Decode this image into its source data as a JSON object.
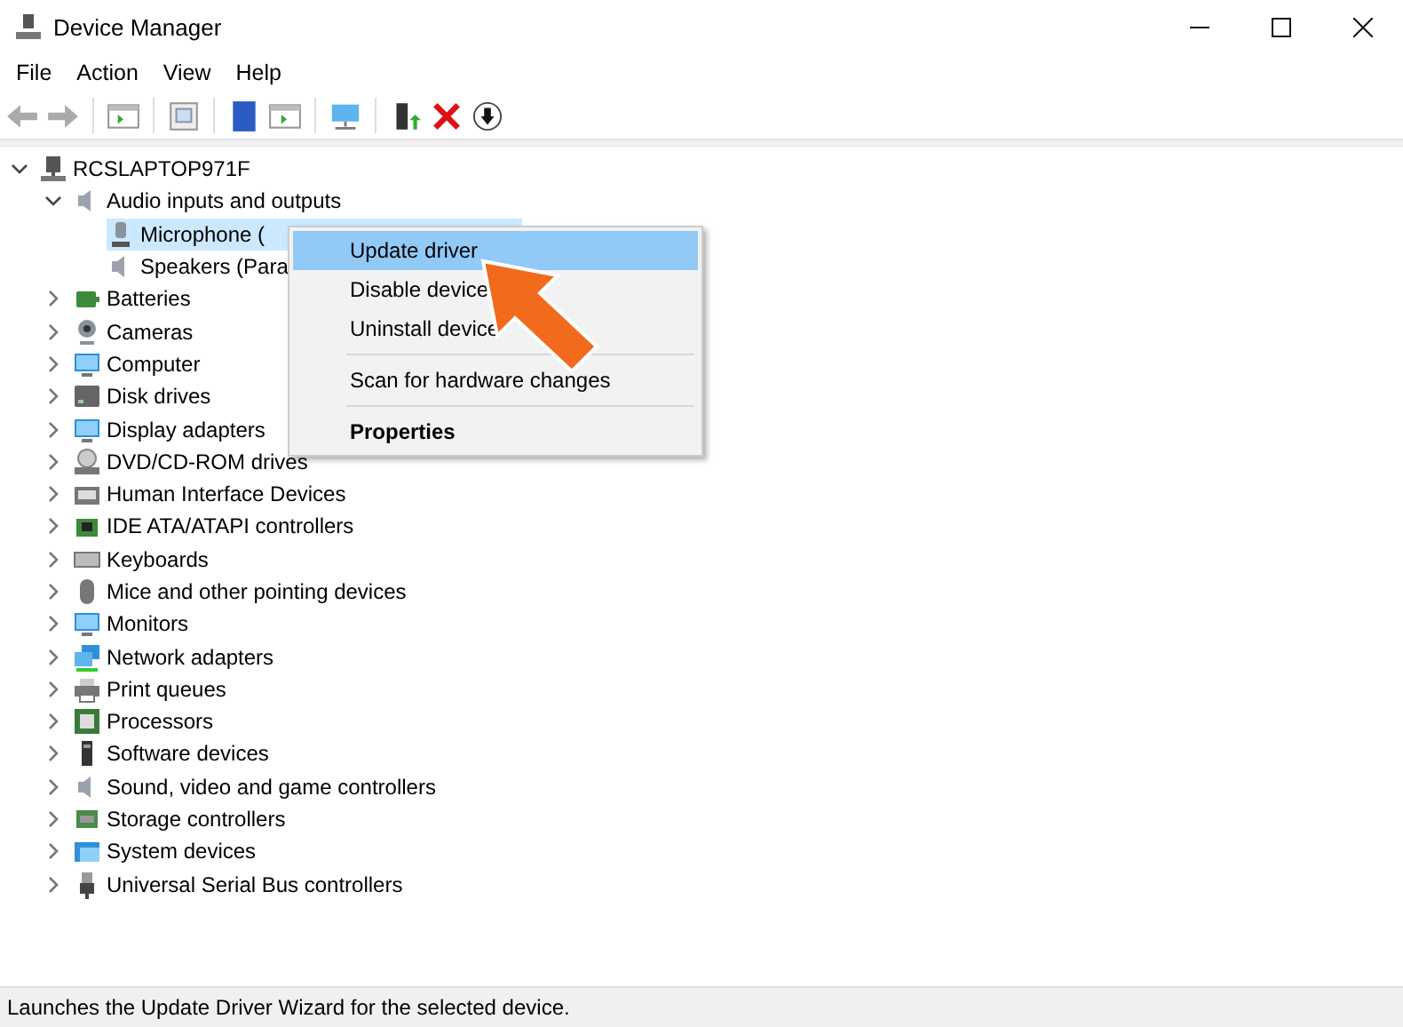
{
  "window": {
    "title": "Device Manager"
  },
  "menu_bar": [
    "File",
    "Action",
    "View",
    "Help"
  ],
  "tree": [
    {
      "label": "RCSLAPTOP971F",
      "expanded": true,
      "selected": false,
      "children": [
        {
          "label": "Audio inputs and outputs",
          "expanded": true,
          "selected": false,
          "children": [
            {
              "label": "Microphone (",
              "selected": true
            },
            {
              "label": "Speakers (Para",
              "selected": false
            }
          ]
        },
        {
          "label": "Batteries",
          "expanded": false,
          "selected": false
        },
        {
          "label": "Cameras",
          "expanded": false,
          "selected": false
        },
        {
          "label": "Computer",
          "expanded": false,
          "selected": false
        },
        {
          "label": "Disk drives",
          "expanded": false,
          "selected": false
        },
        {
          "label": "Display adapters",
          "expanded": false,
          "selected": false
        },
        {
          "label": "DVD/CD-ROM drives",
          "expanded": false,
          "selected": false
        },
        {
          "label": "Human Interface Devices",
          "expanded": false,
          "selected": false
        },
        {
          "label": "IDE ATA/ATAPI controllers",
          "expanded": false,
          "selected": false
        },
        {
          "label": "Keyboards",
          "expanded": false,
          "selected": false
        },
        {
          "label": "Mice and other pointing devices",
          "expanded": false,
          "selected": false
        },
        {
          "label": "Monitors",
          "expanded": false,
          "selected": false
        },
        {
          "label": "Network adapters",
          "expanded": false,
          "selected": false
        },
        {
          "label": "Print queues",
          "expanded": false,
          "selected": false
        },
        {
          "label": "Processors",
          "expanded": false,
          "selected": false
        },
        {
          "label": "Software devices",
          "expanded": false,
          "selected": false
        },
        {
          "label": "Sound, video and game controllers",
          "expanded": false,
          "selected": false
        },
        {
          "label": "Storage controllers",
          "expanded": false,
          "selected": false
        },
        {
          "label": "System devices",
          "expanded": false,
          "selected": false
        },
        {
          "label": "Universal Serial Bus controllers",
          "expanded": false,
          "selected": false
        }
      ]
    }
  ],
  "context_menu": [
    {
      "kind": "item",
      "label": "Update driver",
      "selected": true,
      "default": false
    },
    {
      "kind": "item",
      "label": "Disable device",
      "selected": false,
      "default": false
    },
    {
      "kind": "item",
      "label": "Uninstall device",
      "selected": false,
      "default": false
    },
    {
      "kind": "separator"
    },
    {
      "kind": "item",
      "label": "Scan for hardware changes",
      "selected": false,
      "default": false
    },
    {
      "kind": "separator"
    },
    {
      "kind": "item",
      "label": "Properties",
      "selected": false,
      "default": true
    }
  ],
  "status_bar": "Launches the Update Driver Wizard for the selected device."
}
